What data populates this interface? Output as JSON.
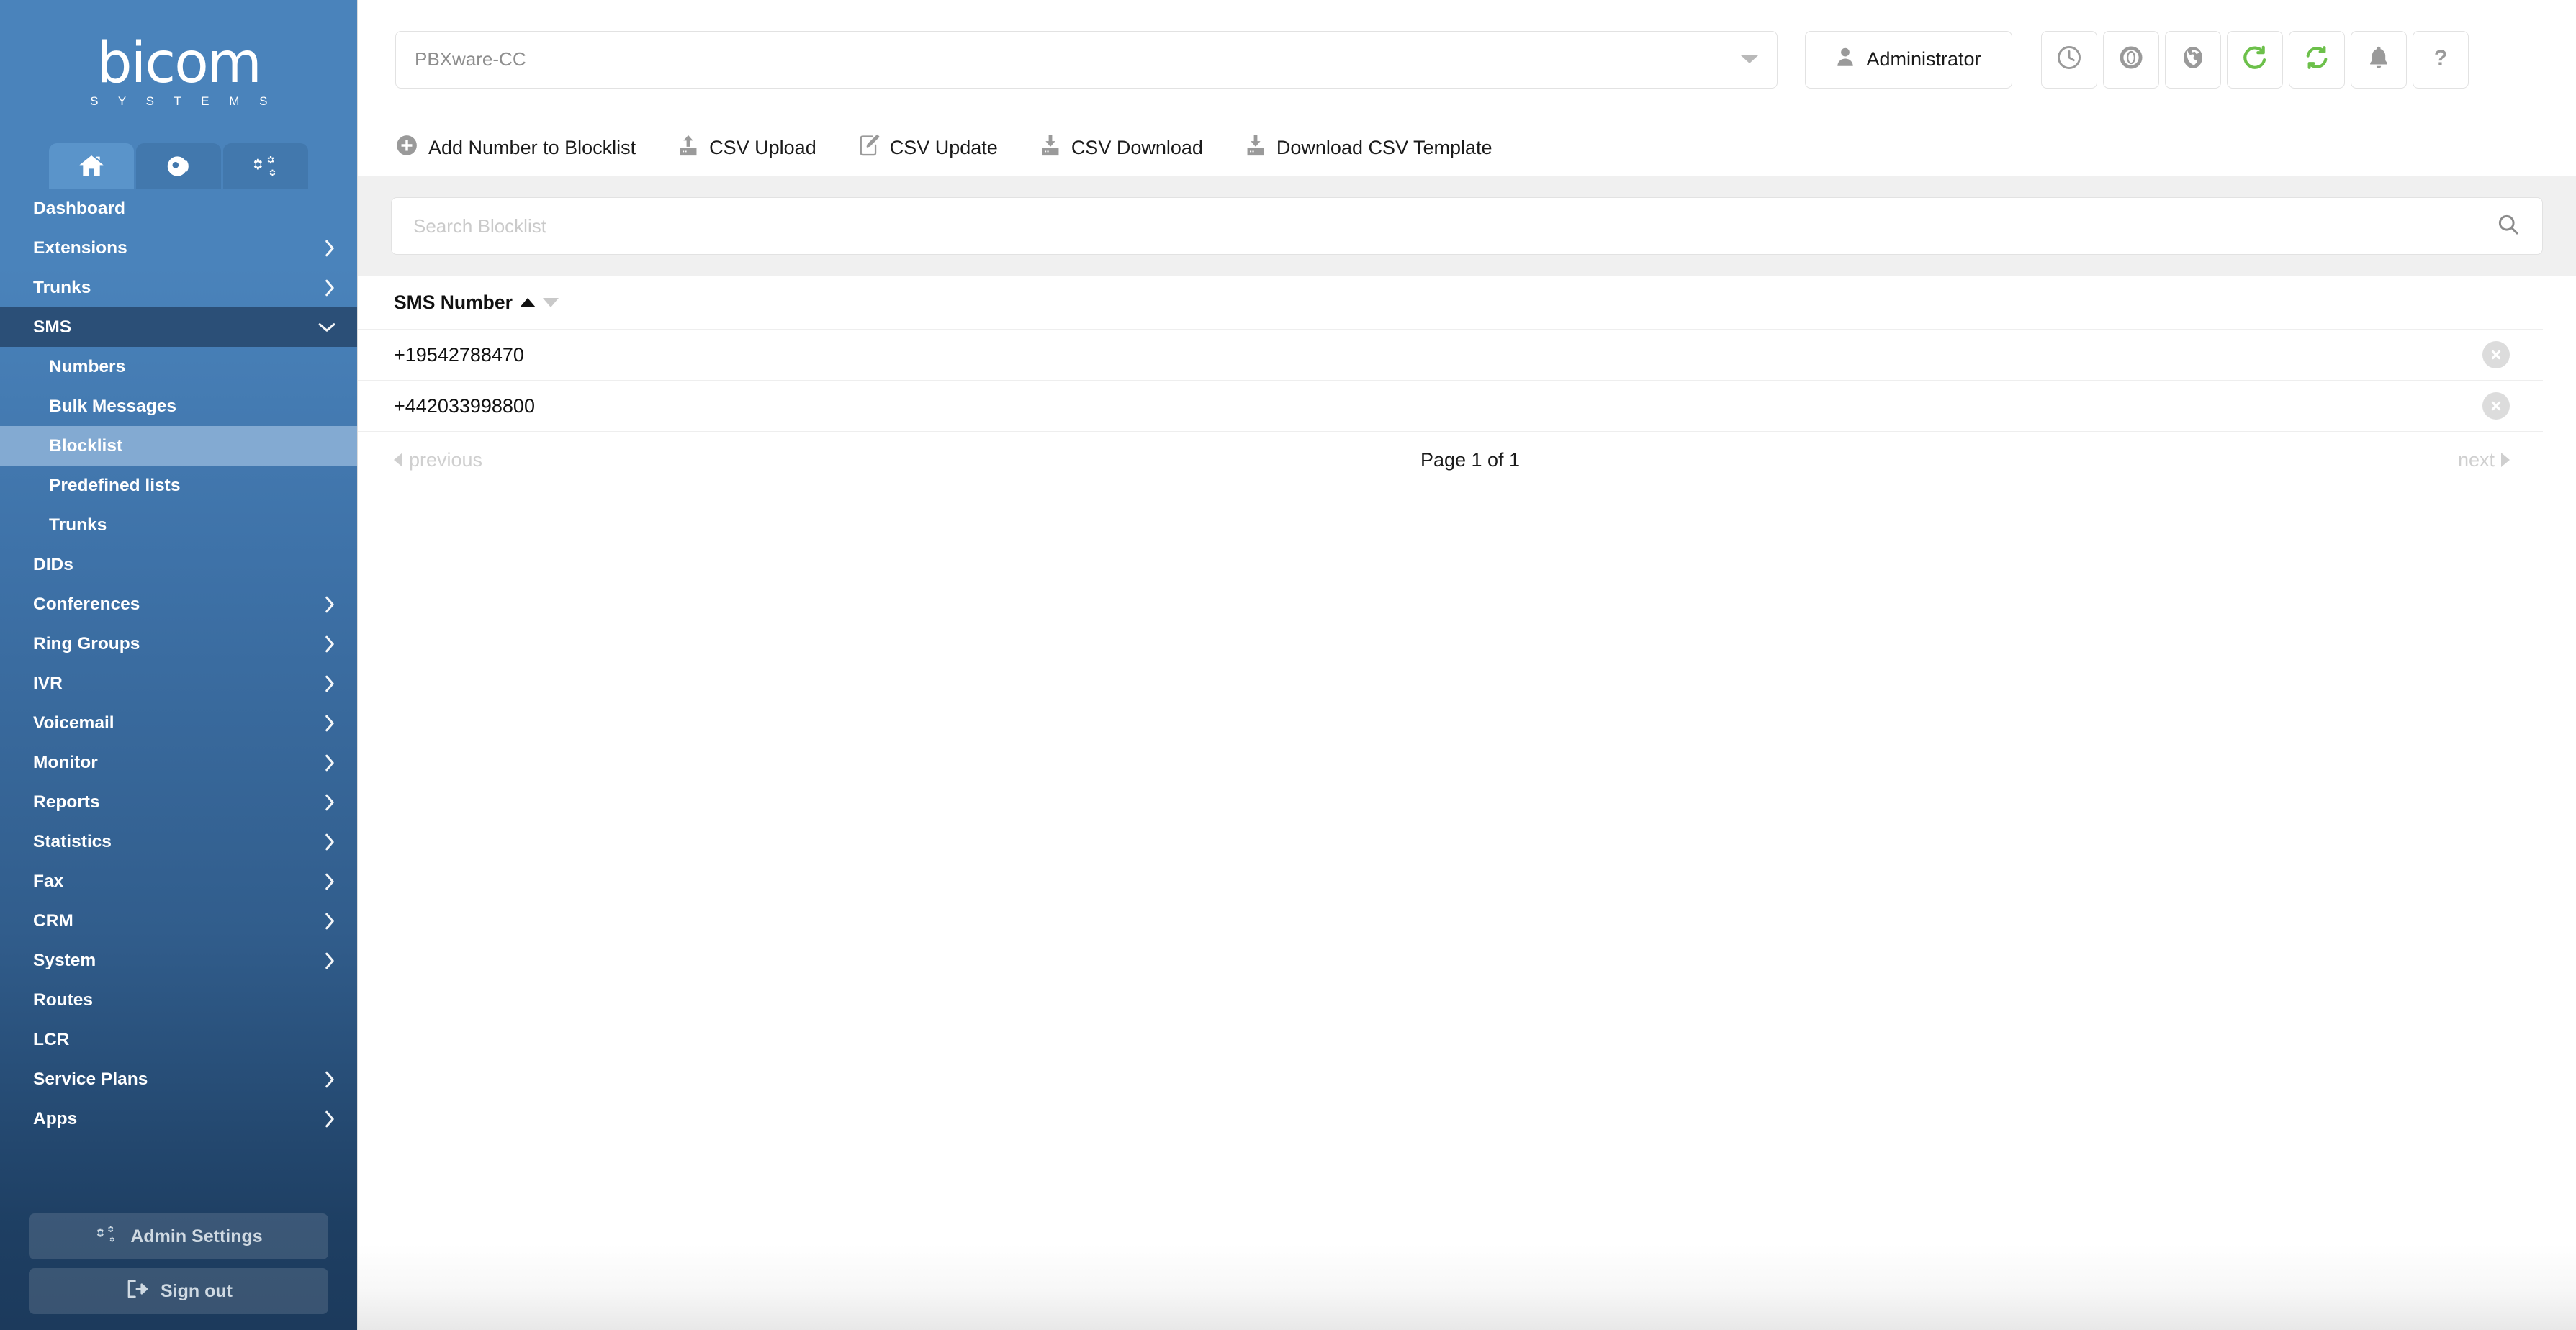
{
  "brand": {
    "name": "bicom",
    "tagline": "S Y S T E M S"
  },
  "sidebar": {
    "tabs": [
      {
        "name": "home-tab",
        "icon": "home-icon",
        "active": true
      },
      {
        "name": "contact-center-tab",
        "icon": "headset-icon",
        "active": false
      },
      {
        "name": "settings-tab",
        "icon": "gears-icon",
        "active": false
      }
    ],
    "items": [
      {
        "label": "Dashboard",
        "has_chevron": false,
        "level": 0
      },
      {
        "label": "Extensions",
        "has_chevron": true,
        "level": 0
      },
      {
        "label": "Trunks",
        "has_chevron": true,
        "level": 0
      },
      {
        "label": "SMS",
        "has_chevron": true,
        "level": 0,
        "expanded": true
      },
      {
        "label": "Numbers",
        "has_chevron": false,
        "level": 1
      },
      {
        "label": "Bulk Messages",
        "has_chevron": false,
        "level": 1
      },
      {
        "label": "Blocklist",
        "has_chevron": false,
        "level": 1,
        "active": true
      },
      {
        "label": "Predefined lists",
        "has_chevron": false,
        "level": 1
      },
      {
        "label": "Trunks",
        "has_chevron": false,
        "level": 1
      },
      {
        "label": "DIDs",
        "has_chevron": false,
        "level": 0
      },
      {
        "label": "Conferences",
        "has_chevron": true,
        "level": 0
      },
      {
        "label": "Ring Groups",
        "has_chevron": true,
        "level": 0
      },
      {
        "label": "IVR",
        "has_chevron": true,
        "level": 0
      },
      {
        "label": "Voicemail",
        "has_chevron": true,
        "level": 0
      },
      {
        "label": "Monitor",
        "has_chevron": true,
        "level": 0
      },
      {
        "label": "Reports",
        "has_chevron": true,
        "level": 0
      },
      {
        "label": "Statistics",
        "has_chevron": true,
        "level": 0
      },
      {
        "label": "Fax",
        "has_chevron": true,
        "level": 0
      },
      {
        "label": "CRM",
        "has_chevron": true,
        "level": 0
      },
      {
        "label": "System",
        "has_chevron": true,
        "level": 0
      },
      {
        "label": "Routes",
        "has_chevron": false,
        "level": 0
      },
      {
        "label": "LCR",
        "has_chevron": false,
        "level": 0
      },
      {
        "label": "Service Plans",
        "has_chevron": true,
        "level": 0
      },
      {
        "label": "Apps",
        "has_chevron": true,
        "level": 0
      }
    ],
    "admin_settings_label": "Admin Settings",
    "sign_out_label": "Sign out"
  },
  "topbar": {
    "server_value": "PBXware-CC",
    "admin_label": "Administrator",
    "icons": [
      {
        "name": "clock-icon",
        "glyph": "clock"
      },
      {
        "name": "life-ring-icon",
        "glyph": "lifering"
      },
      {
        "name": "globe-icon",
        "glyph": "globe"
      },
      {
        "name": "reload-icon",
        "glyph": "reload"
      },
      {
        "name": "sync-icon",
        "glyph": "sync"
      },
      {
        "name": "bell-icon",
        "glyph": "bell"
      },
      {
        "name": "help-icon",
        "glyph": "question"
      }
    ]
  },
  "toolbar": {
    "actions": [
      {
        "label": "Add Number to Blocklist",
        "icon": "plus-circle-icon"
      },
      {
        "label": "CSV Upload",
        "icon": "upload-icon"
      },
      {
        "label": "CSV Update",
        "icon": "edit-icon"
      },
      {
        "label": "CSV Download",
        "icon": "download-icon"
      },
      {
        "label": "Download CSV Template",
        "icon": "download-icon"
      }
    ]
  },
  "search": {
    "placeholder": "Search Blocklist",
    "value": ""
  },
  "table": {
    "columns": [
      {
        "label": "SMS Number",
        "sort": "asc"
      }
    ],
    "rows": [
      {
        "sms_number": "+19542788470"
      },
      {
        "sms_number": "+442033998800"
      }
    ]
  },
  "pagination": {
    "previous_label": "previous",
    "page_label": "Page 1 of 1",
    "next_label": "next"
  },
  "colors": {
    "sidebar_top": "#4a83bb",
    "sidebar_bottom": "#1c3a5c",
    "sidebar_active": "#83aad2",
    "sidebar_expanded": "#2b4f77",
    "accent_green": "#6cc04a",
    "panel_gray": "#f0f0f0",
    "text_dark": "#111111",
    "muted": "#cfcfcf"
  }
}
